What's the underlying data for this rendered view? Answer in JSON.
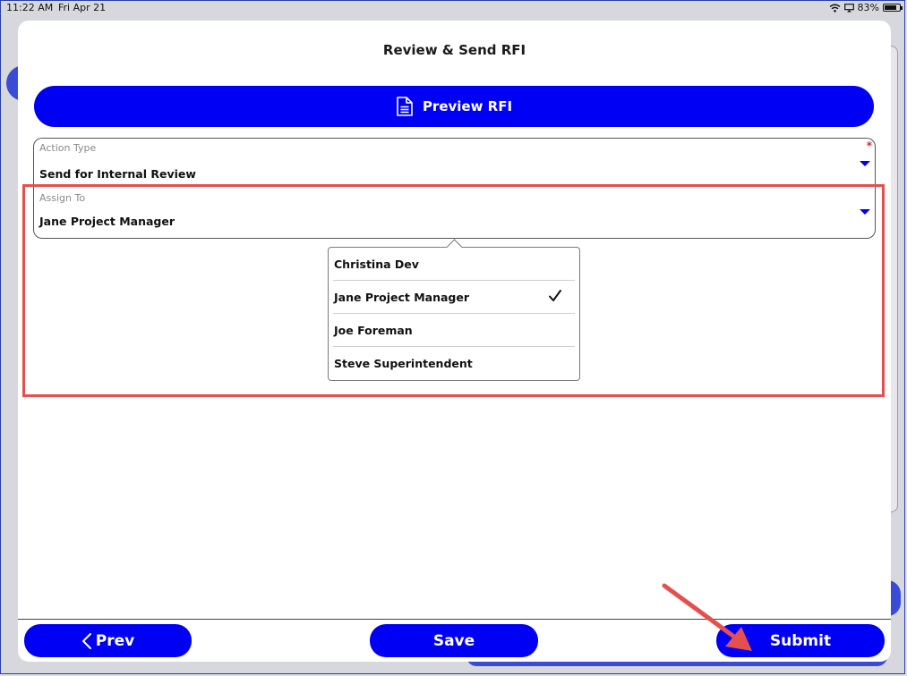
{
  "status_bar": {
    "time": "11:22 AM",
    "date": "Fri Apr 21",
    "battery": "83%",
    "battery_level": 0.83
  },
  "modal": {
    "title": "Review & Send RFI",
    "preview_button": "Preview RFI"
  },
  "action_type": {
    "label": "Action Type",
    "value": "Send for Internal Review",
    "required_mark": "*"
  },
  "assign_to": {
    "label": "Assign To",
    "value": "Jane Project Manager"
  },
  "dropdown": {
    "items": [
      {
        "label": "Christina Dev",
        "selected": false
      },
      {
        "label": "Jane Project Manager",
        "selected": true
      },
      {
        "label": "Joe Foreman",
        "selected": false
      },
      {
        "label": "Steve Superintendent",
        "selected": false
      }
    ]
  },
  "footer": {
    "prev_label": "Prev",
    "save_label": "Save",
    "submit_label": "Submit"
  },
  "colors": {
    "accent": "#0000f5",
    "annotation": "#e5504e",
    "required": "#e0242f"
  },
  "icons": {
    "preview": "document-icon",
    "prev": "chevron-left-icon",
    "check": "checkmark-icon",
    "dropdown": "caret-down-icon"
  }
}
